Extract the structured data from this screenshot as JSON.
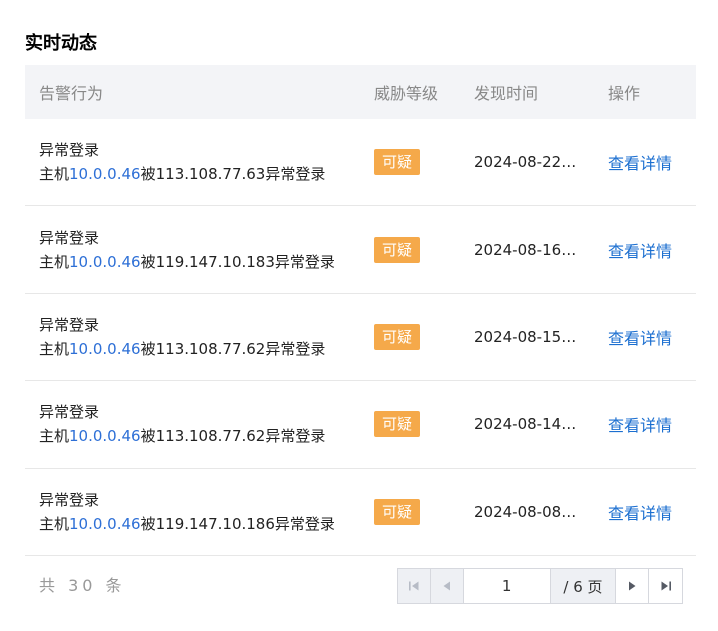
{
  "title": "实时动态",
  "columns": [
    "告警行为",
    "威胁等级",
    "发现时间",
    "操作"
  ],
  "rows": [
    {
      "event": "异常登录",
      "prefix": "主机",
      "host_ip": "10.0.0.46",
      "middle": "被",
      "source_ip": "113.108.77.63",
      "suffix": "异常登录",
      "level": "可疑",
      "time": "2024-08-22 …",
      "action": "查看详情"
    },
    {
      "event": "异常登录",
      "prefix": "主机",
      "host_ip": "10.0.0.46",
      "middle": "被",
      "source_ip": "119.147.10.183",
      "suffix": "异常登录",
      "level": "可疑",
      "time": "2024-08-16 …",
      "action": "查看详情"
    },
    {
      "event": "异常登录",
      "prefix": "主机",
      "host_ip": "10.0.0.46",
      "middle": "被",
      "source_ip": "113.108.77.62",
      "suffix": "异常登录",
      "level": "可疑",
      "time": "2024-08-15 …",
      "action": "查看详情"
    },
    {
      "event": "异常登录",
      "prefix": "主机",
      "host_ip": "10.0.0.46",
      "middle": "被",
      "source_ip": "113.108.77.62",
      "suffix": "异常登录",
      "level": "可疑",
      "time": "2024-08-14 …",
      "action": "查看详情"
    },
    {
      "event": "异常登录",
      "prefix": "主机",
      "host_ip": "10.0.0.46",
      "middle": "被",
      "source_ip": "119.147.10.186",
      "suffix": "异常登录",
      "level": "可疑",
      "time": "2024-08-08 …",
      "action": "查看详情"
    }
  ],
  "footer": {
    "total_text": "共 30 条",
    "current_page": "1",
    "total_pages_text": "/ 6 页"
  },
  "colors": {
    "badge": "#f5a94a",
    "link": "#1c6fd0",
    "ip": "#2d6fd6",
    "header_bg": "#f3f4f7"
  }
}
